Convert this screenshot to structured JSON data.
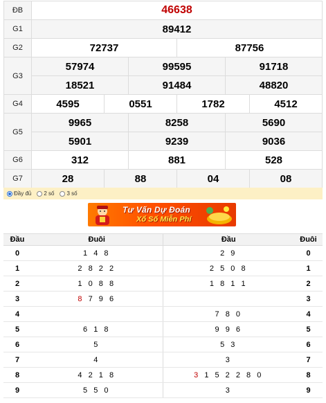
{
  "prizes": {
    "db": {
      "label": "ĐB",
      "nums": [
        "46638"
      ]
    },
    "g1": {
      "label": "G1",
      "nums": [
        "89412"
      ]
    },
    "g2": {
      "label": "G2",
      "nums": [
        "72737",
        "87756"
      ]
    },
    "g3": {
      "label": "G3",
      "nums": [
        "57974",
        "99595",
        "91718",
        "18521",
        "91484",
        "48820"
      ]
    },
    "g4": {
      "label": "G4",
      "nums": [
        "4595",
        "0551",
        "1782",
        "4512"
      ]
    },
    "g5": {
      "label": "G5",
      "nums": [
        "9965",
        "8258",
        "5690",
        "5901",
        "9239",
        "9036"
      ]
    },
    "g6": {
      "label": "G6",
      "nums": [
        "312",
        "881",
        "528"
      ]
    },
    "g7": {
      "label": "G7",
      "nums": [
        "28",
        "88",
        "04",
        "08"
      ]
    }
  },
  "options": [
    {
      "label": "Đầy đủ",
      "selected": true
    },
    {
      "label": "2 số",
      "selected": false
    },
    {
      "label": "3 số",
      "selected": false
    }
  ],
  "banner": {
    "line1": "Tư Vấn Dự Đoán",
    "line2": "Xổ Số Miễn Phí"
  },
  "loto": {
    "headers": [
      "Đầu",
      "Đuôi",
      "Đầu",
      "Đuôi"
    ],
    "rows": [
      {
        "k": "0",
        "tail_hl": "",
        "tail": "1 4 8",
        "head_hl": "",
        "head": "2 9",
        "k2": "0"
      },
      {
        "k": "1",
        "tail_hl": "",
        "tail": "2 8 2 2",
        "head_hl": "",
        "head": "2 5 0 8",
        "k2": "1"
      },
      {
        "k": "2",
        "tail_hl": "",
        "tail": "1 0 8 8",
        "head_hl": "",
        "head": "1 8 1 1",
        "k2": "2"
      },
      {
        "k": "3",
        "tail_hl": "8",
        "tail": " 7 9 6",
        "head_hl": "",
        "head": "",
        "k2": "3"
      },
      {
        "k": "4",
        "tail_hl": "",
        "tail": "",
        "head_hl": "",
        "head": "7 8 0",
        "k2": "4"
      },
      {
        "k": "5",
        "tail_hl": "",
        "tail": "6 1 8",
        "head_hl": "",
        "head": "9 9 6",
        "k2": "5"
      },
      {
        "k": "6",
        "tail_hl": "",
        "tail": "5",
        "head_hl": "",
        "head": "5 3",
        "k2": "6"
      },
      {
        "k": "7",
        "tail_hl": "",
        "tail": "4",
        "head_hl": "",
        "head": "3",
        "k2": "7"
      },
      {
        "k": "8",
        "tail_hl": "",
        "tail": "4 2 1 8",
        "head_hl": "3",
        "head": " 1 5 2 2 8 0",
        "k2": "8"
      },
      {
        "k": "9",
        "tail_hl": "",
        "tail": "5 5 0",
        "head_hl": "",
        "head": "3",
        "k2": "9"
      }
    ]
  }
}
